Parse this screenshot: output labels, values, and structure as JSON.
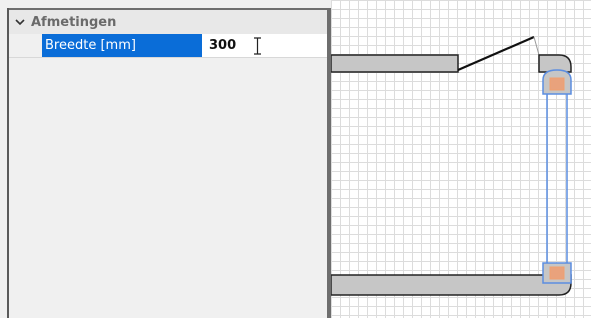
{
  "properties": {
    "category": {
      "label": "Afmetingen",
      "expand_icon": "chevron-down-icon"
    },
    "rows": [
      {
        "name": "Breedte [mm]",
        "value": "300",
        "selected": true
      }
    ]
  },
  "colors": {
    "selection_blue": "#0a6dd8",
    "handle_orange": "#f0a070",
    "handle_fill": "#e9a27c",
    "wall_gray": "#c6c6c6",
    "outline_blue": "#5b8de0"
  }
}
